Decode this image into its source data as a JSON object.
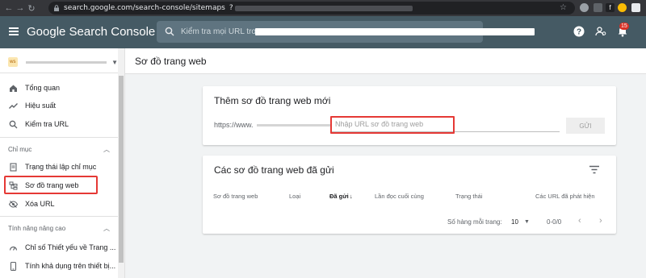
{
  "browser": {
    "url": "search.google.com/search-console/sitemaps",
    "url_suffix": "?"
  },
  "header": {
    "brand": "Google Search Console",
    "search_placeholder": "Kiểm tra mọi URL trong",
    "notification_count": "15"
  },
  "sidebar": {
    "items_main": [
      {
        "label": "Tổng quan",
        "icon": "home-icon"
      },
      {
        "label": "Hiệu suất",
        "icon": "trending-up-icon"
      },
      {
        "label": "Kiểm tra URL",
        "icon": "search-icon"
      }
    ],
    "section_index": "Chỉ mục",
    "items_index": [
      {
        "label": "Trạng thái lập chỉ mục",
        "icon": "document-icon"
      },
      {
        "label": "Sơ đồ trang web",
        "icon": "sitemap-icon"
      },
      {
        "label": "Xóa URL",
        "icon": "remove-eye-icon"
      }
    ],
    "section_advanced": "Tính năng nâng cao",
    "items_advanced": [
      {
        "label": "Chỉ số Thiết yếu về Trang ...",
        "icon": "gauge-icon"
      },
      {
        "label": "Tính khả dụng trên thiết bị...",
        "icon": "phone-icon"
      }
    ]
  },
  "page": {
    "title": "Sơ đồ trang web"
  },
  "add_card": {
    "title": "Thêm sơ đồ trang web mới",
    "prefix": "https://www.",
    "input_placeholder": "Nhập URL sơ đồ trang web",
    "submit_label": "GỬI"
  },
  "list_card": {
    "title": "Các sơ đồ trang web đã gửi",
    "columns": [
      "Sơ đồ trang web",
      "Loại",
      "Đã gửi",
      "Lần đọc cuối cùng",
      "Trạng thái",
      "Các URL đã phát hiện"
    ],
    "sort_arrow": "↓",
    "rows_per_page_label": "Số hàng mỗi trang:",
    "rows_per_page_value": "10",
    "range": "0-0/0"
  },
  "colors": {
    "header_bg": "#455a64",
    "highlight": "#e53935",
    "main_bg": "#f1f3f4"
  }
}
